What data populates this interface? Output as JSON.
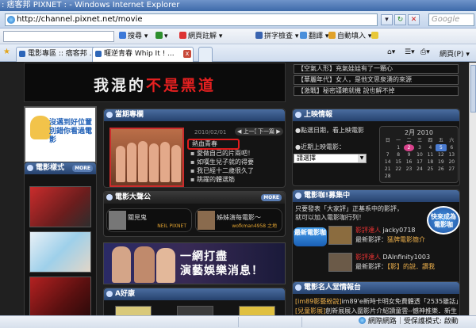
{
  "window": {
    "title": ": 痞客邦 PIXNET : - Windows Internet Explorer"
  },
  "address": {
    "url": "http://channel.pixnet.net/movie",
    "search_placeholder": "Google"
  },
  "toolbar": {
    "search": "搜尋",
    "translate_page": "網頁註解",
    "spellcheck": "拼字檢查",
    "translate": "翻譯",
    "autofill": "自動填入"
  },
  "tabs": [
    {
      "label": "電影專區 :: 痞客邦 ..."
    },
    {
      "label": "暱逆青春 Whip It ! ..."
    }
  ],
  "commandbar": {
    "page": "網頁(P)"
  },
  "banner": {
    "part1": "我混的",
    "part2": "不是黑道"
  },
  "news": [
    "【空氣人形】充氣娃娃有了一顆心",
    "【華麗年代】女人，是他文思泉湧的來源",
    "【激戰】秘密謹賴就機 說也解不掉"
  ],
  "mascot": {
    "line1": "沒邁到好位置",
    "line2": "別錯你看過電影"
  },
  "sections": {
    "movie_style": "電影樣式",
    "feature": "當期專欄",
    "fans": "電影大聲公",
    "showtimes": "上映情報",
    "recruit": "電影咖!募集中",
    "quotes": "電影名人堂情報台",
    "health": "A好康",
    "more": "MORE"
  },
  "feature": {
    "date": "2010/02/01",
    "prev": "◀ 上一篇",
    "next": "下一篇 ▶",
    "hot": "熱血青春",
    "headlines": [
      "愛做自己的片兩吧！",
      "如嘆生兒子就的得要",
      "我已經十二歲很久了",
      "跳躍的體選筋"
    ]
  },
  "fans": [
    {
      "name": "關見鬼",
      "sig": "NEIL PIXNET"
    },
    {
      "name": "姊姊演每電影～",
      "sig": "wofkman4958 之地"
    }
  ],
  "promo": {
    "line1": "一網打盡",
    "line2": "演藝娛樂消息！"
  },
  "showtimes": {
    "line1": "●點選日期，看上映電影",
    "line2": "●近期上映電影：",
    "select": "請選擇",
    "calendar_title": "2月 2010",
    "weekdays": [
      "日",
      "一",
      "二",
      "三",
      "四",
      "五",
      "六"
    ],
    "days": [
      "",
      "1",
      "2",
      "3",
      "4",
      "5",
      "6",
      "7",
      "8",
      "9",
      "10",
      "11",
      "12",
      "13",
      "14",
      "15",
      "16",
      "17",
      "18",
      "19",
      "20",
      "21",
      "22",
      "23",
      "24",
      "25",
      "26",
      "27",
      "28"
    ],
    "selected_day": "2",
    "today": "5"
  },
  "recruit": {
    "desc1": "只要發表「大家評」正基系中的影評，",
    "desc2": "就可以加入電影咖行列！",
    "badge": "快來成為電影咖"
  },
  "reviews": {
    "badge": "最新電影咖",
    "items": [
      {
        "user_prefix": "影評達人",
        "user": "jacky0718",
        "label": "最新影評：",
        "title": "猛牌電影簡介"
      },
      {
        "user_prefix": "影評達人",
        "user": "DAInfinity1003",
        "label": "最新影評：",
        "title": "【影】的說．讚我"
      }
    ]
  },
  "quotes": [
    {
      "user": "[im89影藝紛說]",
      "text": "im89'e新時卡明女免費體透「2535雖話」路"
    },
    {
      "user": "[兒童影展]",
      "text": "創新展展入圍影片介紹讀童雲--憾神推樂．新生"
    }
  ],
  "statusbar": {
    "zone": "網際網路｜受保護模式: 啟動"
  },
  "colors": {
    "accent": "#e52020",
    "panel_header": "#3c5f94"
  }
}
